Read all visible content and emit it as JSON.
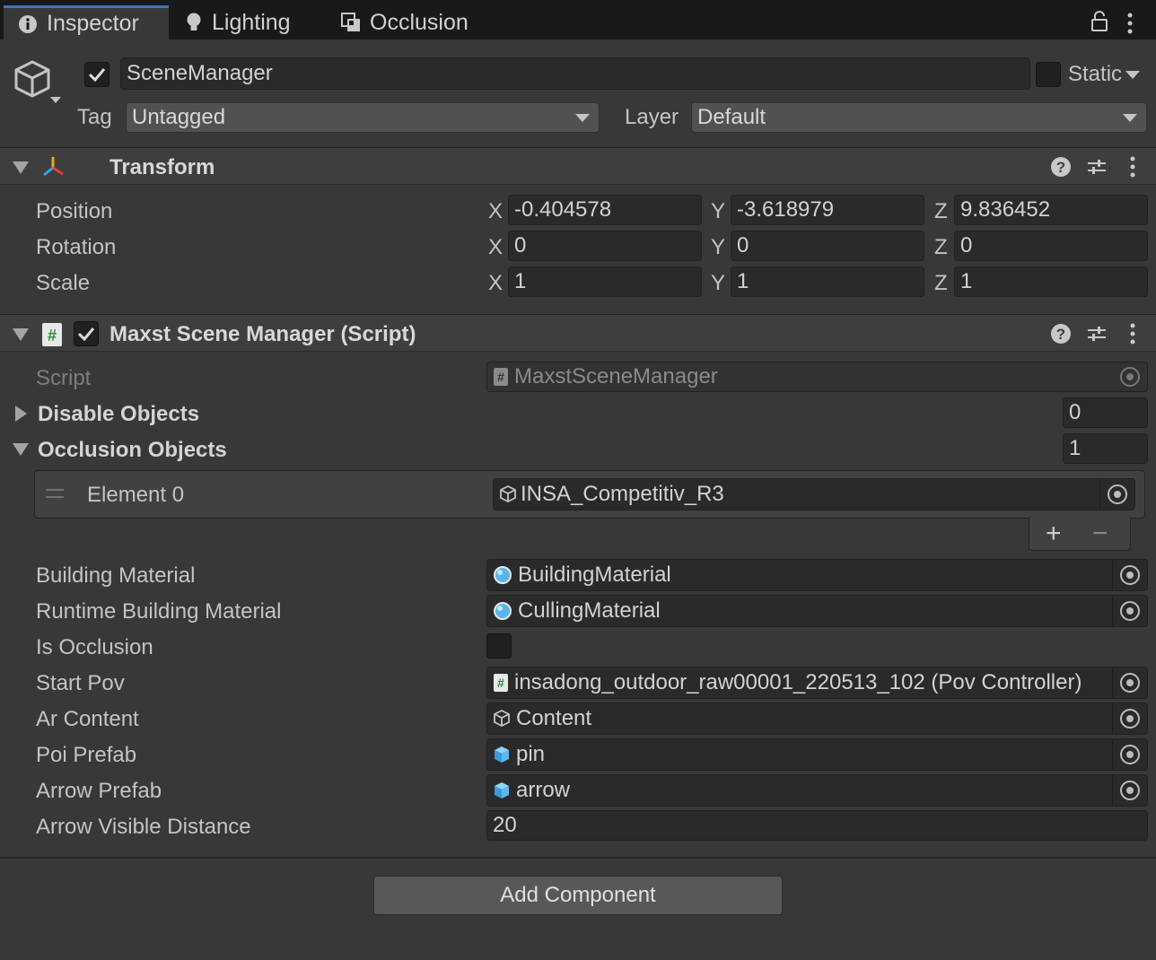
{
  "tabs": [
    {
      "label": "Inspector",
      "icon": "info-icon"
    },
    {
      "label": "Lighting",
      "icon": "bulb-icon"
    },
    {
      "label": "Occlusion",
      "icon": "occlusion-icon"
    }
  ],
  "gameobject": {
    "name": "SceneManager",
    "static_label": "Static",
    "tag_label": "Tag",
    "tag_value": "Untagged",
    "layer_label": "Layer",
    "layer_value": "Default"
  },
  "transform": {
    "title": "Transform",
    "rows": [
      {
        "label": "Position",
        "x": "-0.404578",
        "y": "-3.618979",
        "z": "9.836452"
      },
      {
        "label": "Rotation",
        "x": "0",
        "y": "0",
        "z": "0"
      },
      {
        "label": "Scale",
        "x": "1",
        "y": "1",
        "z": "1"
      }
    ],
    "axes": {
      "x": "X",
      "y": "Y",
      "z": "Z"
    }
  },
  "script_component": {
    "title": "Maxst Scene Manager (Script)",
    "script_label": "Script",
    "script_value": "MaxstSceneManager",
    "disable_objects_label": "Disable Objects",
    "disable_objects_count": "0",
    "occlusion_objects_label": "Occlusion Objects",
    "occlusion_objects_count": "1",
    "element0_label": "Element 0",
    "element0_value": "INSA_Competitiv_R3",
    "add_symbol": "+",
    "remove_symbol": "−",
    "fields": [
      {
        "label": "Building Material",
        "value": "BuildingMaterial",
        "icon": "material-icon"
      },
      {
        "label": "Runtime Building Material",
        "value": "CullingMaterial",
        "icon": "material-icon"
      },
      {
        "label": "Is Occlusion",
        "value": "",
        "icon": "checkbox"
      },
      {
        "label": "Start Pov",
        "value": "insadong_outdoor_raw00001_220513_102 (Pov Controller)",
        "icon": "script-icon"
      },
      {
        "label": "Ar Content",
        "value": "Content",
        "icon": "gameobject-icon"
      },
      {
        "label": "Poi Prefab",
        "value": "pin",
        "icon": "prefab-icon"
      },
      {
        "label": "Arrow Prefab",
        "value": "arrow",
        "icon": "prefab-icon"
      },
      {
        "label": "Arrow Visible Distance",
        "value": "20",
        "icon": ""
      }
    ]
  },
  "add_component_label": "Add Component",
  "colors": {
    "background": "#383838",
    "accent": "#3a79bb",
    "field": "#2a2a2a"
  }
}
